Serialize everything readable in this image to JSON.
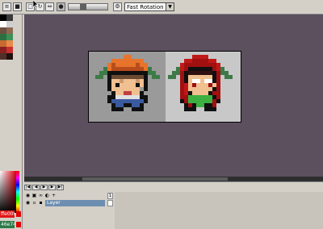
{
  "toolbar": {
    "rotation_select": {
      "value": "Fast Rotation"
    },
    "zoom": {
      "level_fraction": 0.35
    }
  },
  "palette": {
    "colors": [
      "#000000",
      "#3a3a3a",
      "#ffffff",
      "#d0d0d0",
      "#6c5040",
      "#8c6a50",
      "#2c7040",
      "#3c9058",
      "#c86a30",
      "#e88a48",
      "#8a2020",
      "#c83030",
      "#503028",
      "#201010"
    ]
  },
  "color_picker": {
    "primary_hex": "ffe000",
    "primary_color": "#e01818",
    "secondary_hex": "46e74",
    "secondary_color": "#2a7a48"
  },
  "timeline": {
    "frame_number": "1",
    "layer_name": "Layer"
  },
  "colors": {
    "canvas_background": "#5c4f5e",
    "layer_selected": "#6d8eb0"
  }
}
